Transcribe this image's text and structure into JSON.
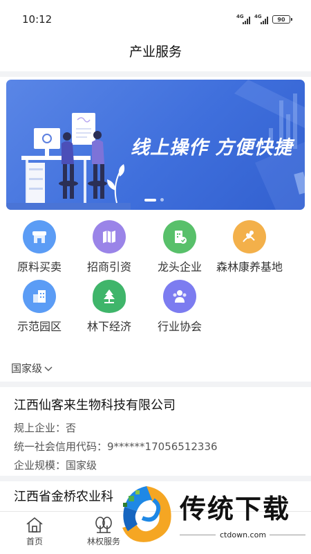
{
  "status_bar": {
    "time": "10:12",
    "network_1": "4G",
    "network_2": "4G",
    "battery": "90"
  },
  "header": {
    "title": "产业服务"
  },
  "banner": {
    "headline": "线上操作   方便快捷"
  },
  "services": [
    {
      "label": "原料买卖",
      "icon": "store-icon",
      "color": "#5b9cf5"
    },
    {
      "label": "招商引资",
      "icon": "map-icon",
      "color": "#9a84e8"
    },
    {
      "label": "龙头企业",
      "icon": "building-check-icon",
      "color": "#58c06a"
    },
    {
      "label": "森林康养基地",
      "icon": "health-care-icon",
      "color": "#f3b04a"
    },
    {
      "label": "示范园区",
      "icon": "park-buildings-icon",
      "color": "#5b9cf5"
    },
    {
      "label": "林下经济",
      "icon": "tree-location-icon",
      "color": "#3fb56a"
    },
    {
      "label": "行业协会",
      "icon": "people-group-icon",
      "color": "#7c7cf0"
    }
  ],
  "filter": {
    "level": "国家级"
  },
  "companies": [
    {
      "name": "江西仙客来生物科技有限公司",
      "scale_above_label": "规上企业：",
      "scale_above_value": "否",
      "credit_code_label": "统一社会信用代码：",
      "credit_code_value": "9******17056512336",
      "size_label": "企业规模：",
      "size_value": "国家级"
    },
    {
      "name": "江西省金桥农业科"
    }
  ],
  "bottom_nav": [
    {
      "label": "首页",
      "icon": "home-icon"
    },
    {
      "label": "林权服务",
      "icon": "trees-icon"
    }
  ],
  "watermark": {
    "brand": "传统下载",
    "url": "ctdown.com"
  }
}
